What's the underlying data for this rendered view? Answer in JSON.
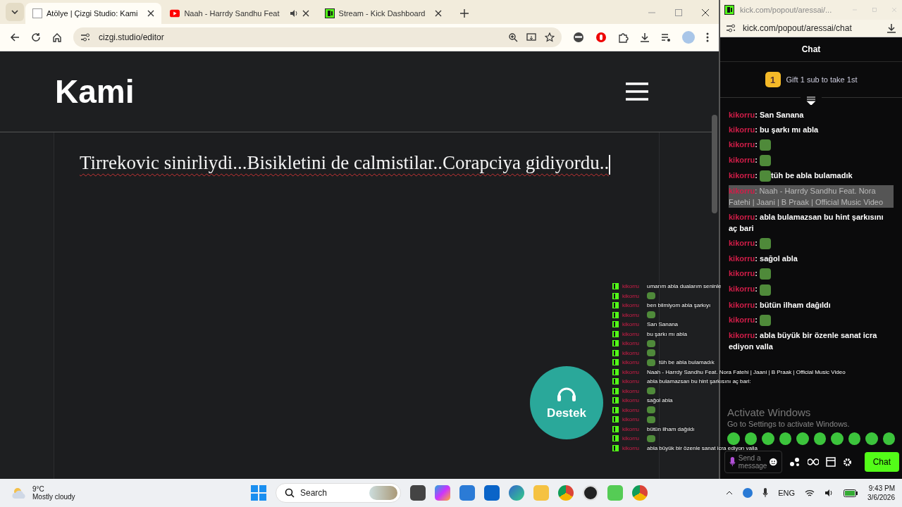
{
  "browser": {
    "tabs": [
      {
        "title": "Atölye | Çizgi Studio: Kami",
        "selected": true,
        "kind": "site",
        "audio": false
      },
      {
        "title": "Naah - Harrdy Sandhu Feat",
        "selected": false,
        "kind": "video",
        "audio": true
      },
      {
        "title": "Stream - Kick Dashboard",
        "selected": false,
        "kind": "kick",
        "audio": false
      }
    ],
    "address": "cizgi.studio/editor"
  },
  "page": {
    "logo": "Kami",
    "editor_text": "Tirrekovic sinirliydi...Bisikletini de calmistilar..Corapciya gidiyordu.."
  },
  "overlay_chat": {
    "messages": [
      {
        "user": "kikorru",
        "kind": "text",
        "text": "umarım abla dualarım seninle"
      },
      {
        "user": "kikorru",
        "kind": "emote"
      },
      {
        "user": "kikorru",
        "kind": "text",
        "text": "ben bilmiyom abla şarkıyı"
      },
      {
        "user": "kikorru",
        "kind": "emote"
      },
      {
        "user": "kikorru",
        "kind": "text",
        "text": "San Sanana"
      },
      {
        "user": "kikorru",
        "kind": "text",
        "text": "bu şarkı mı abla"
      },
      {
        "user": "kikorru",
        "kind": "emote"
      },
      {
        "user": "kikorru",
        "kind": "emote"
      },
      {
        "user": "kikorru",
        "kind": "emote_text",
        "text": "tüh be abla bulamadık"
      },
      {
        "user": "kikorru",
        "kind": "text",
        "text": "Naah - Harrdy Sandhu Feat. Nora Fatehi | Jaani | B Praak | Official Music Video"
      },
      {
        "user": "kikorru",
        "kind": "text",
        "text": "abla bulamazsan bu hint şarkısını aç bari:"
      },
      {
        "user": "kikorru",
        "kind": "emote"
      },
      {
        "user": "kikorru",
        "kind": "text",
        "text": "sağol abla"
      },
      {
        "user": "kikorru",
        "kind": "emote"
      },
      {
        "user": "kikorru",
        "kind": "emote"
      },
      {
        "user": "kikorru",
        "kind": "text",
        "text": "bütün ilham dağıldı"
      },
      {
        "user": "kikorru",
        "kind": "emote"
      },
      {
        "user": "kikorru",
        "kind": "text",
        "text": "abla büyük bir özenle sanat icra ediyon valla"
      }
    ]
  },
  "support_button": {
    "label": "Destek"
  },
  "popout": {
    "title": "kick.com/popout/aressai/...",
    "address": "kick.com/popout/aressai/chat",
    "header": "Chat",
    "gift_badge": "1",
    "gift_text": "Gift 1 sub to take 1st",
    "messages": [
      {
        "user": "kikorru",
        "kind": "text",
        "text": "San Sanana",
        "highlighted": false
      },
      {
        "user": "kikorru",
        "kind": "text",
        "text": "bu şarkı mı abla",
        "highlighted": false
      },
      {
        "user": "kikorru",
        "kind": "emote",
        "highlighted": false
      },
      {
        "user": "kikorru",
        "kind": "emote",
        "highlighted": false
      },
      {
        "user": "kikorru",
        "kind": "emote_text",
        "text": "tüh be abla bulamadık",
        "highlighted": false
      },
      {
        "user": "kikorru",
        "kind": "text",
        "text": "Naah - Harrdy Sandhu Feat. Nora Fatehi | Jaani | B Praak | Official Music Video",
        "highlighted": true
      },
      {
        "user": "kikorru",
        "kind": "text",
        "text": "abla bulamazsan bu hint şarkısını aç bari",
        "highlighted": false
      },
      {
        "user": "kikorru",
        "kind": "emote",
        "highlighted": false
      },
      {
        "user": "kikorru",
        "kind": "text",
        "text": "sağol abla",
        "highlighted": false
      },
      {
        "user": "kikorru",
        "kind": "emote",
        "highlighted": false
      },
      {
        "user": "kikorru",
        "kind": "emote",
        "highlighted": false
      },
      {
        "user": "kikorru",
        "kind": "text",
        "text": "bütün ilham dağıldı",
        "highlighted": false
      },
      {
        "user": "kikorru",
        "kind": "emote",
        "highlighted": false
      },
      {
        "user": "kikorru",
        "kind": "text",
        "text": "abla büyük bir özenle sanat icra ediyon valla",
        "highlighted": false
      }
    ],
    "separator": ":",
    "message_placeholder": "Send a message",
    "send_label": "Chat"
  },
  "activation": {
    "title": "Activate Windows",
    "text": "Go to Settings to activate Windows."
  },
  "taskbar": {
    "temperature": "9°C",
    "condition": "Mostly cloudy",
    "search_placeholder": "Search",
    "language": "ENG",
    "time": "9:43 PM",
    "date": "3/6/2026"
  }
}
